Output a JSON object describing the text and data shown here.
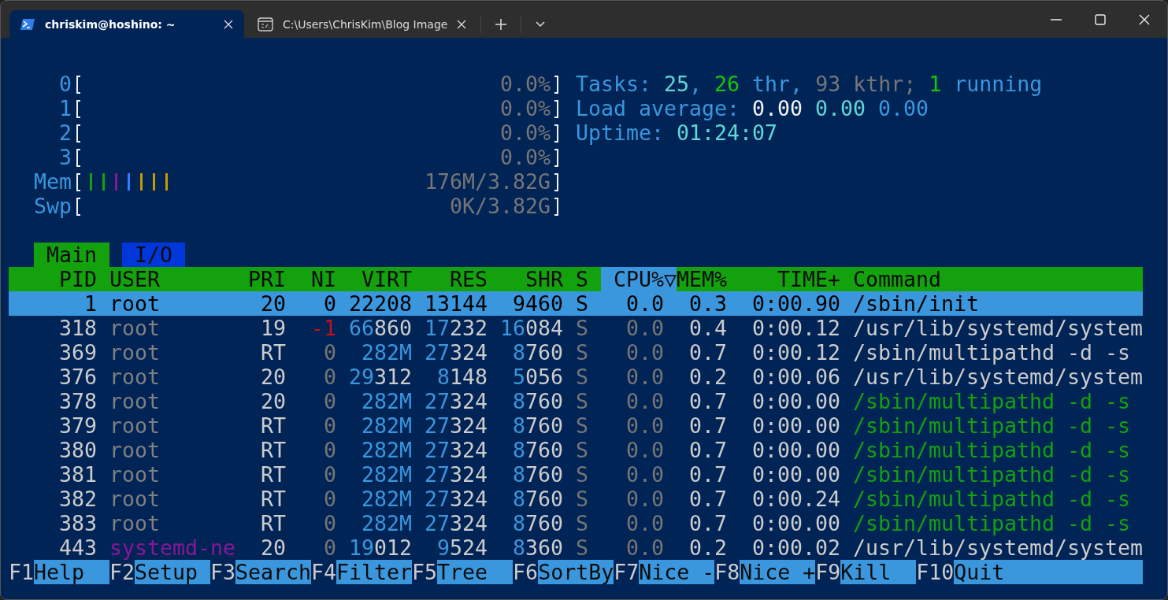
{
  "tabs": [
    {
      "title": "chriskim@hoshino: ~",
      "kind": "powershell",
      "selected": true
    },
    {
      "title": "C:\\Users\\ChrisKim\\Blog Image",
      "kind": "cmd",
      "selected": false
    }
  ],
  "meters": [
    {
      "label": "0",
      "value": "0.0%"
    },
    {
      "label": "1",
      "value": "0.0%"
    },
    {
      "label": "2",
      "value": "0.0%"
    },
    {
      "label": "3",
      "value": "0.0%"
    },
    {
      "label": "Mem",
      "value": "176M/3.82G",
      "segments": [
        {
          "color": "#13a10e"
        },
        {
          "color": "#13a10e"
        },
        {
          "color": "#881798"
        },
        {
          "color": "#3b78ff"
        },
        {
          "color": "#c19c00"
        },
        {
          "color": "#c19c00"
        },
        {
          "color": "#c19c00"
        }
      ]
    },
    {
      "label": "Swp",
      "value": "0K/3.82G"
    }
  ],
  "info_lines": [
    [
      {
        "text": "Tasks: ",
        "color": "#3a96dd"
      },
      {
        "text": "25",
        "color": "#61d6d6"
      },
      {
        "text": ", ",
        "color": "#3a96dd"
      },
      {
        "text": "26",
        "color": "#16c60c"
      },
      {
        "text": " thr, ",
        "color": "#3a96dd"
      },
      {
        "text": "93 kthr; ",
        "color": "#767676"
      },
      {
        "text": "1",
        "color": "#16c60c"
      },
      {
        "text": " running",
        "color": "#3a96dd"
      }
    ],
    [
      {
        "text": "Load average: ",
        "color": "#3a96dd"
      },
      {
        "text": "0.00 ",
        "color": "#f2f2f2"
      },
      {
        "text": "0.00 ",
        "color": "#61d6d6"
      },
      {
        "text": "0.00",
        "color": "#3a96dd"
      }
    ],
    [
      {
        "text": "Uptime: ",
        "color": "#3a96dd"
      },
      {
        "text": "01:24:07",
        "color": "#61d6d6"
      }
    ]
  ],
  "screen_tabs": [
    {
      "label": "Main",
      "selected": true
    },
    {
      "label": "I/O",
      "selected": false
    }
  ],
  "table": {
    "columns": [
      {
        "label": "PID",
        "sorted": false
      },
      {
        "label": "USER",
        "sorted": false
      },
      {
        "label": "PRI",
        "sorted": false
      },
      {
        "label": "NI",
        "sorted": false
      },
      {
        "label": "VIRT",
        "sorted": false
      },
      {
        "label": "RES",
        "sorted": false
      },
      {
        "label": "SHR",
        "sorted": false
      },
      {
        "label": "S",
        "sorted": false
      },
      {
        "label": "CPU%▽",
        "sorted": true
      },
      {
        "label": "MEM%",
        "sorted": false
      },
      {
        "label": "TIME+",
        "sorted": false
      },
      {
        "label": "Command",
        "sorted": false
      }
    ],
    "rows": [
      {
        "selected": true,
        "pid": "1",
        "user": "root",
        "pri": "20",
        "ni": "0",
        "virt": {
          "lo": "22208"
        },
        "res": {
          "lo": "13144"
        },
        "shr": {
          "lo": "9460"
        },
        "s": "S",
        "cpu": "0.0",
        "mem": "0.3",
        "time": "0:00.90",
        "command": "/sbin/init"
      },
      {
        "selected": false,
        "thread": false,
        "pid": "318",
        "user": "root",
        "root_user": true,
        "pri": "19",
        "ni": "-1",
        "negative_nice": true,
        "virt": {
          "hi": "66",
          "lo": "860"
        },
        "res": {
          "hi": "17",
          "lo": "232"
        },
        "shr": {
          "hi": "16",
          "lo": "084"
        },
        "s": "S",
        "cpu": "0.0",
        "mem": "0.4",
        "time": "0:00.12",
        "command": "/usr/lib/systemd/system"
      },
      {
        "selected": false,
        "thread": false,
        "pid": "369",
        "user": "root",
        "root_user": true,
        "pri": "RT",
        "ni": "0",
        "negative_nice": false,
        "virt": {
          "hi": "282M"
        },
        "res": {
          "hi": "27",
          "lo": "324"
        },
        "shr": {
          "hi": "8",
          "lo": "760"
        },
        "s": "S",
        "cpu": "0.0",
        "mem": "0.7",
        "time": "0:00.12",
        "command": "/sbin/multipathd -d -s"
      },
      {
        "selected": false,
        "thread": false,
        "pid": "376",
        "user": "root",
        "root_user": true,
        "pri": "20",
        "ni": "0",
        "negative_nice": false,
        "virt": {
          "hi": "29",
          "lo": "312"
        },
        "res": {
          "hi": "8",
          "lo": "148"
        },
        "shr": {
          "hi": "5",
          "lo": "056"
        },
        "s": "S",
        "cpu": "0.0",
        "mem": "0.2",
        "time": "0:00.06",
        "command": "/usr/lib/systemd/system"
      },
      {
        "selected": false,
        "thread": true,
        "pid": "378",
        "user": "root",
        "root_user": true,
        "pri": "20",
        "ni": "0",
        "negative_nice": false,
        "virt": {
          "hi": "282M"
        },
        "res": {
          "hi": "27",
          "lo": "324"
        },
        "shr": {
          "hi": "8",
          "lo": "760"
        },
        "s": "S",
        "cpu": "0.0",
        "mem": "0.7",
        "time": "0:00.00",
        "command": "/sbin/multipathd -d -s"
      },
      {
        "selected": false,
        "thread": true,
        "pid": "379",
        "user": "root",
        "root_user": true,
        "pri": "RT",
        "ni": "0",
        "negative_nice": false,
        "virt": {
          "hi": "282M"
        },
        "res": {
          "hi": "27",
          "lo": "324"
        },
        "shr": {
          "hi": "8",
          "lo": "760"
        },
        "s": "S",
        "cpu": "0.0",
        "mem": "0.7",
        "time": "0:00.00",
        "command": "/sbin/multipathd -d -s"
      },
      {
        "selected": false,
        "thread": true,
        "pid": "380",
        "user": "root",
        "root_user": true,
        "pri": "RT",
        "ni": "0",
        "negative_nice": false,
        "virt": {
          "hi": "282M"
        },
        "res": {
          "hi": "27",
          "lo": "324"
        },
        "shr": {
          "hi": "8",
          "lo": "760"
        },
        "s": "S",
        "cpu": "0.0",
        "mem": "0.7",
        "time": "0:00.00",
        "command": "/sbin/multipathd -d -s"
      },
      {
        "selected": false,
        "thread": true,
        "pid": "381",
        "user": "root",
        "root_user": true,
        "pri": "RT",
        "ni": "0",
        "negative_nice": false,
        "virt": {
          "hi": "282M"
        },
        "res": {
          "hi": "27",
          "lo": "324"
        },
        "shr": {
          "hi": "8",
          "lo": "760"
        },
        "s": "S",
        "cpu": "0.0",
        "mem": "0.7",
        "time": "0:00.00",
        "command": "/sbin/multipathd -d -s"
      },
      {
        "selected": false,
        "thread": true,
        "pid": "382",
        "user": "root",
        "root_user": true,
        "pri": "RT",
        "ni": "0",
        "negative_nice": false,
        "virt": {
          "hi": "282M"
        },
        "res": {
          "hi": "27",
          "lo": "324"
        },
        "shr": {
          "hi": "8",
          "lo": "760"
        },
        "s": "S",
        "cpu": "0.0",
        "mem": "0.7",
        "time": "0:00.24",
        "command": "/sbin/multipathd -d -s"
      },
      {
        "selected": false,
        "thread": true,
        "pid": "383",
        "user": "root",
        "root_user": true,
        "pri": "RT",
        "ni": "0",
        "negative_nice": false,
        "virt": {
          "hi": "282M"
        },
        "res": {
          "hi": "27",
          "lo": "324"
        },
        "shr": {
          "hi": "8",
          "lo": "760"
        },
        "s": "S",
        "cpu": "0.0",
        "mem": "0.7",
        "time": "0:00.00",
        "command": "/sbin/multipathd -d -s"
      },
      {
        "selected": false,
        "thread": false,
        "pid": "443",
        "user": "systemd-ne",
        "root_user": false,
        "pri": "20",
        "ni": "0",
        "negative_nice": false,
        "virt": {
          "hi": "19",
          "lo": "012"
        },
        "res": {
          "hi": "9",
          "lo": "524"
        },
        "shr": {
          "hi": "8",
          "lo": "360"
        },
        "s": "S",
        "cpu": "0.0",
        "mem": "0.2",
        "time": "0:00.02",
        "command": "/usr/lib/systemd/system"
      }
    ]
  },
  "function_keys": [
    {
      "key": "F1",
      "label": "Help"
    },
    {
      "key": "F2",
      "label": "Setup"
    },
    {
      "key": "F3",
      "label": "Search"
    },
    {
      "key": "F4",
      "label": "Filter"
    },
    {
      "key": "F5",
      "label": "Tree"
    },
    {
      "key": "F6",
      "label": "SortBy"
    },
    {
      "key": "F7",
      "label": "Nice -"
    },
    {
      "key": "F8",
      "label": "Nice +"
    },
    {
      "key": "F9",
      "label": "Kill"
    },
    {
      "key": "F10",
      "label": "Quit"
    }
  ]
}
